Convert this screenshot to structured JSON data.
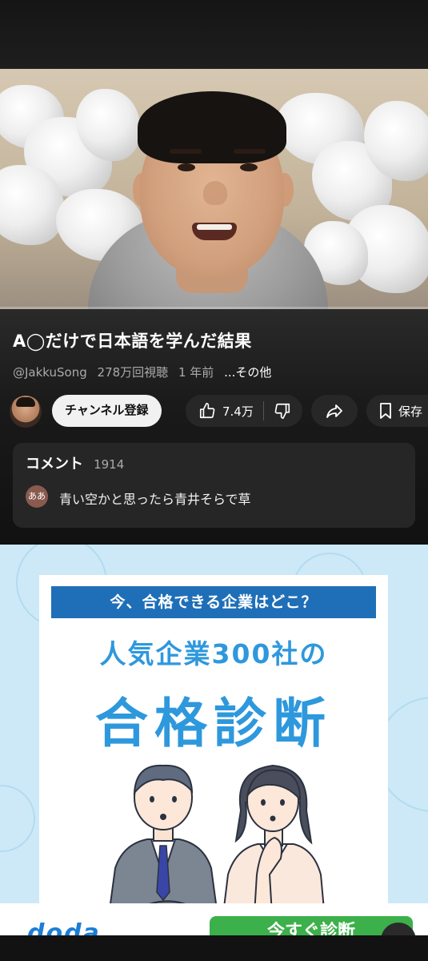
{
  "video": {
    "title": "A◯だけで日本語を学んだ結果",
    "channel_handle": "@JakkuSong",
    "views": "278万回視聴",
    "age": "1 年前",
    "more": "...その他",
    "progress_fraction": 0.0
  },
  "actions": {
    "subscribe_label": "チャンネル登録",
    "like_count": "7.4万",
    "save_label": "保存"
  },
  "comments": {
    "label": "コメント",
    "count": "1914",
    "top_avatar": "ああ",
    "top_comment": "青い空かと思ったら青井そらで草"
  },
  "ad": {
    "banner": "今、合格できる企業はどこ？",
    "line1": "人気企業300社の",
    "line2": "合格診断",
    "brand": "doda",
    "cta": "今すぐ診断",
    "colors": {
      "banner": "#1f6fb8",
      "headline": "#2e98dd",
      "cta": "#3cb04a",
      "background": "#cde9f7"
    }
  }
}
